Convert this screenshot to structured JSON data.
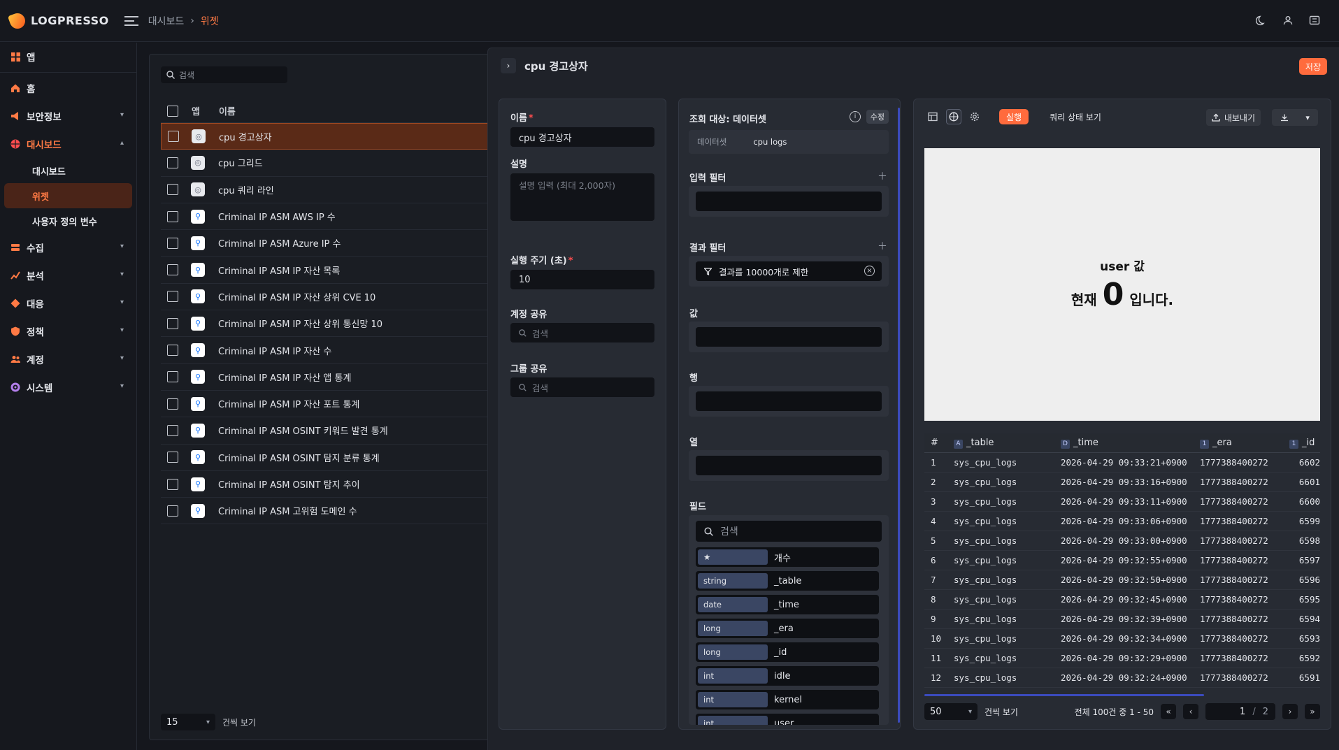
{
  "app": {
    "brand": "LOGPRESSO"
  },
  "breadcrumb": [
    "대시보드",
    "위젯"
  ],
  "sidebar": {
    "items": [
      {
        "label": "앱",
        "icon": "apps-icon"
      },
      {
        "label": "홈",
        "icon": "home-icon"
      },
      {
        "label": "보안정보",
        "icon": "security-info-icon"
      },
      {
        "label": "대시보드",
        "icon": "dashboard-icon"
      },
      {
        "label": "수집",
        "icon": "collect-icon"
      },
      {
        "label": "분석",
        "icon": "analysis-icon"
      },
      {
        "label": "대응",
        "icon": "response-icon"
      },
      {
        "label": "정책",
        "icon": "policy-icon"
      },
      {
        "label": "계정",
        "icon": "account-icon"
      },
      {
        "label": "시스템",
        "icon": "system-icon"
      }
    ],
    "sub_items": [
      "대시보드",
      "위젯",
      "사용자 정의 변수"
    ]
  },
  "widget_list": {
    "search_placeholder": "검색",
    "col_app": "앱",
    "col_name": "이름",
    "rows": [
      "cpu 경고상자",
      "cpu 그리드",
      "cpu 쿼리 라인",
      "Criminal IP ASM AWS IP 수",
      "Criminal IP ASM Azure IP 수",
      "Criminal IP ASM IP 자산 목록",
      "Criminal IP ASM IP 자산 상위 CVE 10",
      "Criminal IP ASM IP 자산 상위 통신망 10",
      "Criminal IP ASM IP 자산 수",
      "Criminal IP ASM IP 자산 앱 통계",
      "Criminal IP ASM IP 자산 포트 통계",
      "Criminal IP ASM OSINT 키워드 발견 통계",
      "Criminal IP ASM OSINT 탐지 분류 통계",
      "Criminal IP ASM OSINT 탐지 추이",
      "Criminal IP ASM 고위험 도메인 수"
    ],
    "page_size": "15",
    "page_size_label": "건씩 보기"
  },
  "editor": {
    "title": "cpu 경고상자",
    "save_label": "저장",
    "name_label": "이름",
    "name_value": "cpu 경고상자",
    "desc_label": "설명",
    "desc_placeholder": "설명 입력 (최대 2,000자)",
    "interval_label": "실행 주기 (초)",
    "interval_value": "10",
    "account_share_label": "계정 공유",
    "group_share_label": "그룹 공유",
    "share_placeholder": "검색"
  },
  "query": {
    "source_label": "조회 대상: 데이터셋",
    "edit_label": "수정",
    "source_type": "데이터셋",
    "source_name": "cpu logs",
    "input_filter_label": "입력 필터",
    "result_filter_label": "결과 필터",
    "result_filter_chip": "결과를 10000개로 제한",
    "value_label": "값",
    "row_label": "행",
    "column_label": "열",
    "fields_label": "필드",
    "field_search_placeholder": "검색",
    "fields": [
      {
        "type": "★",
        "name": "개수"
      },
      {
        "type": "string",
        "name": "_table"
      },
      {
        "type": "date",
        "name": "_time"
      },
      {
        "type": "long",
        "name": "_era"
      },
      {
        "type": "long",
        "name": "_id"
      },
      {
        "type": "int",
        "name": "idle"
      },
      {
        "type": "int",
        "name": "kernel"
      },
      {
        "type": "int",
        "name": "user"
      }
    ]
  },
  "preview": {
    "run_label": "실행",
    "query_status_label": "쿼리 상태 보기",
    "export_label": "내보내기",
    "widget_title": "user 값",
    "line_prefix": "현재",
    "value": "0",
    "line_suffix": "입니다.",
    "table": {
      "headers": [
        {
          "badge": "",
          "label": "#"
        },
        {
          "badge": "A",
          "label": "_table"
        },
        {
          "badge": "D",
          "label": "_time"
        },
        {
          "badge": "1",
          "label": "_era"
        },
        {
          "badge": "1",
          "label": "_id"
        }
      ],
      "rows": [
        [
          "1",
          "sys_cpu_logs",
          "2026-04-29 09:33:21+0900",
          "1777388400272",
          "6602"
        ],
        [
          "2",
          "sys_cpu_logs",
          "2026-04-29 09:33:16+0900",
          "1777388400272",
          "6601"
        ],
        [
          "3",
          "sys_cpu_logs",
          "2026-04-29 09:33:11+0900",
          "1777388400272",
          "6600"
        ],
        [
          "4",
          "sys_cpu_logs",
          "2026-04-29 09:33:06+0900",
          "1777388400272",
          "6599"
        ],
        [
          "5",
          "sys_cpu_logs",
          "2026-04-29 09:33:00+0900",
          "1777388400272",
          "6598"
        ],
        [
          "6",
          "sys_cpu_logs",
          "2026-04-29 09:32:55+0900",
          "1777388400272",
          "6597"
        ],
        [
          "7",
          "sys_cpu_logs",
          "2026-04-29 09:32:50+0900",
          "1777388400272",
          "6596"
        ],
        [
          "8",
          "sys_cpu_logs",
          "2026-04-29 09:32:45+0900",
          "1777388400272",
          "6595"
        ],
        [
          "9",
          "sys_cpu_logs",
          "2026-04-29 09:32:39+0900",
          "1777388400272",
          "6594"
        ],
        [
          "10",
          "sys_cpu_logs",
          "2026-04-29 09:32:34+0900",
          "1777388400272",
          "6593"
        ],
        [
          "11",
          "sys_cpu_logs",
          "2026-04-29 09:32:29+0900",
          "1777388400272",
          "6592"
        ],
        [
          "12",
          "sys_cpu_logs",
          "2026-04-29 09:32:24+0900",
          "1777388400272",
          "6591"
        ]
      ]
    },
    "page_size": "50",
    "page_size_label": "건씩 보기",
    "total_label": "전체 100건 중 1 - 50",
    "current_page": "1",
    "total_pages": "2"
  },
  "colors": {
    "accent": "#ff6b3d",
    "selected_row": "#5a2a17"
  }
}
